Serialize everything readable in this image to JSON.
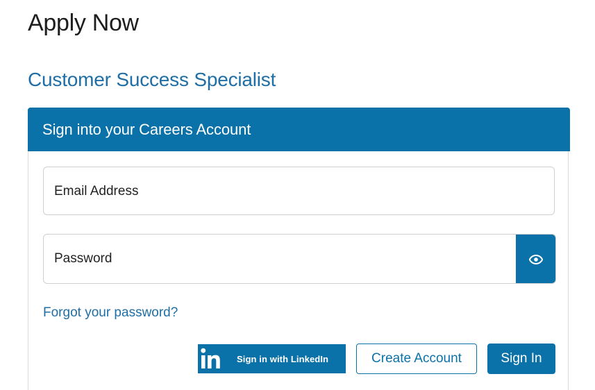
{
  "page": {
    "title": "Apply Now",
    "job_title": "Customer Success Specialist"
  },
  "login_card": {
    "header": "Sign into your Careers Account",
    "email_field": {
      "label": "Email Address",
      "value": ""
    },
    "password_field": {
      "label": "Password",
      "value": "",
      "reveal_icon": "eye-icon"
    },
    "forgot_password_link": "Forgot your password?",
    "linkedin_button": {
      "logo_text": "in",
      "label": "Sign in with LinkedIn"
    },
    "create_account_button": "Create Account",
    "sign_in_button": "Sign In"
  },
  "colors": {
    "brand_blue": "#0a72a8",
    "link_blue": "#1f6fa6",
    "text": "#222222",
    "border": "#cfcfcf"
  }
}
